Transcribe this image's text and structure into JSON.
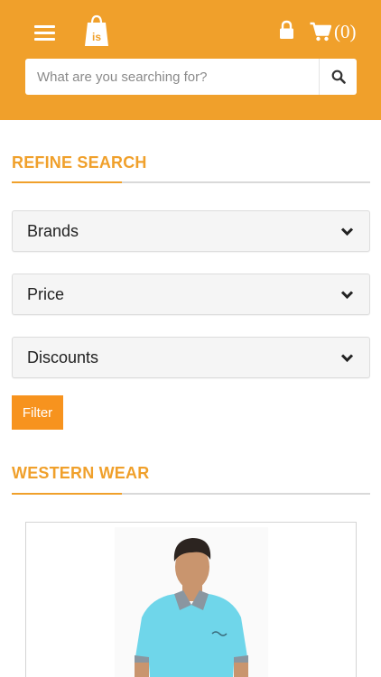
{
  "header": {
    "cart_count": "(0)",
    "icons": [
      "menu-icon",
      "logo-shopping-bag",
      "lock-icon",
      "cart-icon"
    ],
    "logo_text": "is"
  },
  "search": {
    "placeholder": "What are you searching for?",
    "value": ""
  },
  "refine": {
    "title": "REFINE SEARCH",
    "sections": [
      {
        "label": "Brands"
      },
      {
        "label": "Price"
      },
      {
        "label": "Discounts"
      }
    ],
    "filter_label": "Filter"
  },
  "category": {
    "title": "WESTERN WEAR"
  },
  "colors": {
    "brand": "#f0a02b",
    "button": "#f7931e",
    "panel": "#f5f5f5",
    "shirt": "#6fd6ea"
  }
}
